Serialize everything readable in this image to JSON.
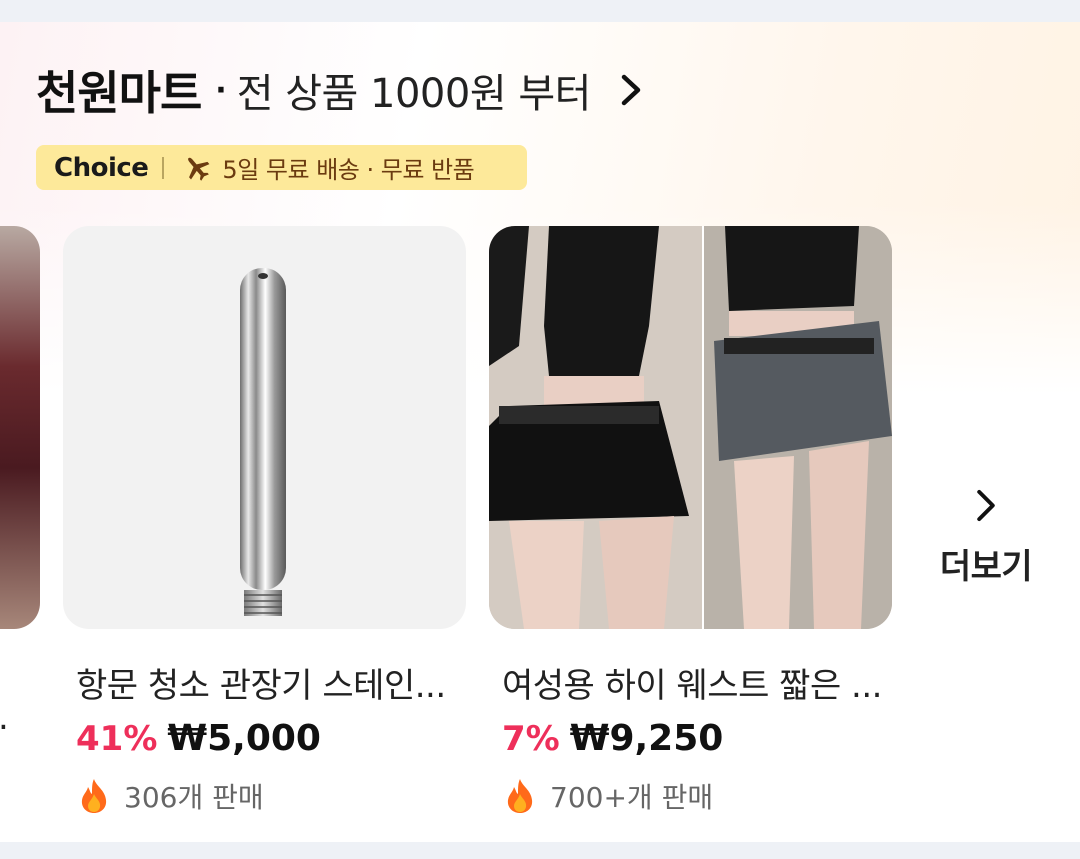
{
  "section": {
    "title": "천원마트",
    "separator": "·",
    "subtitle": "전 상품 1000원 부터",
    "chevron_icon": "chevron-right-icon"
  },
  "badge": {
    "brand": "Choice",
    "icon": "airplane-icon",
    "text": "5일 무료 배송 · 무료 반품",
    "bg_color": "#fde99a"
  },
  "products": [
    {
      "name": "항문 청소 관장기 스테인...",
      "discount": "41%",
      "price": "₩5,000",
      "sold": "306개 판매",
      "image": "stainless-steel-tube-image"
    },
    {
      "name": "여성용 하이 웨스트 짧은 ...",
      "discount": "7%",
      "price": "₩9,250",
      "sold": "700+개 판매",
      "image": "pleated-mini-skirt-image"
    }
  ],
  "partial_text": ".",
  "more": {
    "label": "더보기",
    "icon": "chevron-right-icon"
  },
  "colors": {
    "discount": "#ee2f5a",
    "accent_badge": "#fde99a"
  }
}
